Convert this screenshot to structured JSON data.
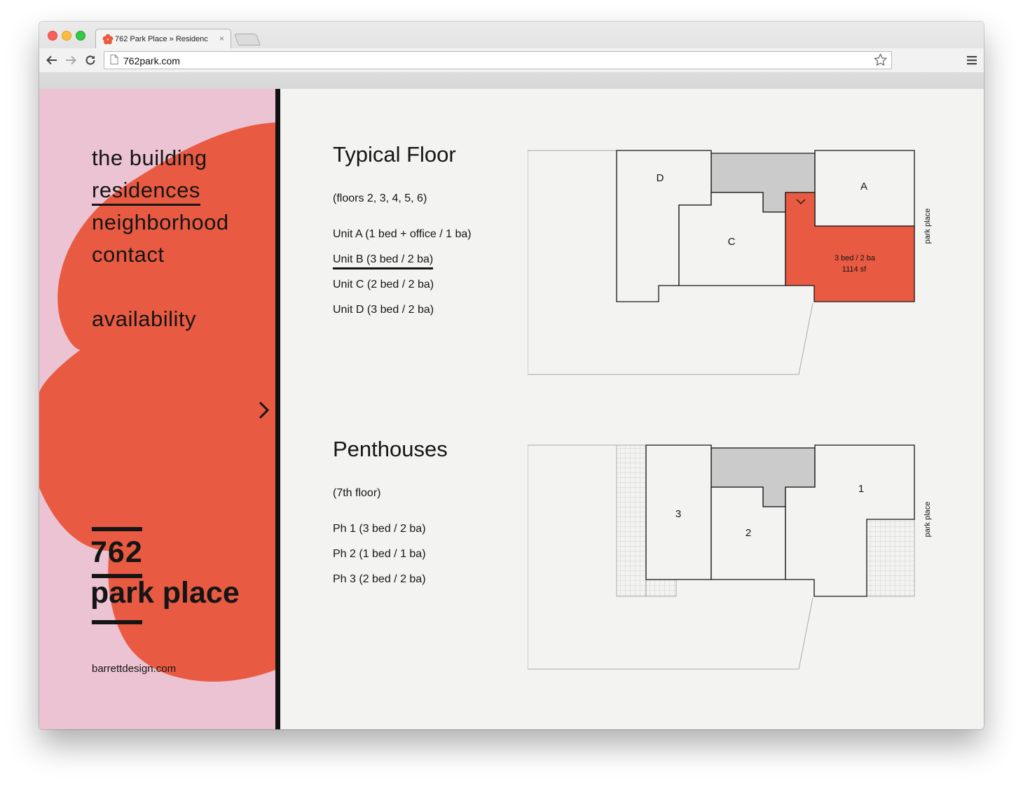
{
  "browser": {
    "tab_title": "762 Park Place » Residenc",
    "tab_close": "×",
    "url": "762park.com"
  },
  "nav": {
    "items": [
      {
        "label": "the building"
      },
      {
        "label": "residences"
      },
      {
        "label": "neighborhood"
      },
      {
        "label": "contact"
      }
    ],
    "availability": "availability"
  },
  "logo": {
    "line1": "762",
    "line2": "park place"
  },
  "credit": "barrettdesign.com",
  "colors": {
    "accent": "#e95a42",
    "sidebar_bg": "#ebc3d2",
    "core_gray": "#cbcbcb",
    "page_bg": "#f3f3f2",
    "ink": "#151515"
  },
  "typical": {
    "title": "Typical Floor",
    "subtitle": "(floors 2, 3, 4, 5, 6)",
    "units": [
      {
        "label": "Unit A (1 bed + office / 1 ba)"
      },
      {
        "label": "Unit B (3 bed / 2 ba)"
      },
      {
        "label": "Unit C (2 bed / 2 ba)"
      },
      {
        "label": "Unit D (3 bed / 2 ba)"
      }
    ],
    "selected_unit": "Unit B (3 bed / 2 ba)",
    "plan": {
      "unit_labels": [
        "D",
        "C",
        "A"
      ],
      "selected_detail_line1": "3 bed / 2 ba",
      "selected_detail_line2": "1114 sf",
      "street": "park place"
    }
  },
  "penthouses": {
    "title": "Penthouses",
    "subtitle": "(7th floor)",
    "units": [
      {
        "label": "Ph 1 (3 bed / 2 ba)"
      },
      {
        "label": "Ph 2 (1 bed / 1 ba)"
      },
      {
        "label": "Ph 3 (2 bed / 2 ba)"
      }
    ],
    "plan": {
      "unit_labels": [
        "3",
        "2",
        "1"
      ],
      "street": "park place"
    }
  }
}
